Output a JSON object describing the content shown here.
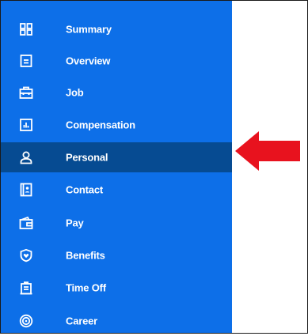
{
  "sidebar": {
    "accent": "#0d6fe8",
    "active_color": "#064b92",
    "items": [
      {
        "label": "Summary",
        "icon": "grid-icon"
      },
      {
        "label": "Overview",
        "icon": "document-icon"
      },
      {
        "label": "Job",
        "icon": "briefcase-icon"
      },
      {
        "label": "Compensation",
        "icon": "bar-chart-icon"
      },
      {
        "label": "Personal",
        "icon": "person-icon",
        "active": true
      },
      {
        "label": "Contact",
        "icon": "contact-card-icon"
      },
      {
        "label": "Pay",
        "icon": "wallet-icon"
      },
      {
        "label": "Benefits",
        "icon": "shield-heart-icon"
      },
      {
        "label": "Time Off",
        "icon": "clipboard-icon"
      },
      {
        "label": "Career",
        "icon": "target-icon"
      }
    ]
  },
  "annotation": {
    "arrow_color": "#e8121e",
    "arrow_icon": "red-arrow-left-icon"
  }
}
